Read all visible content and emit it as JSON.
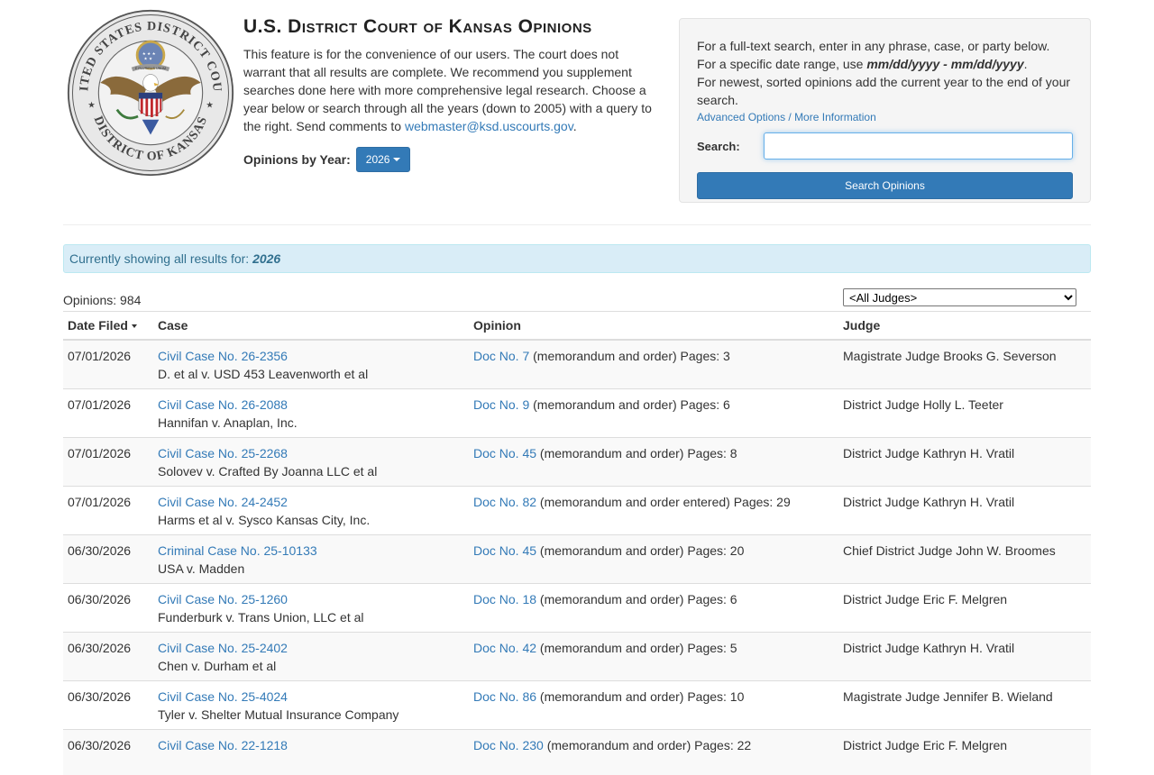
{
  "header": {
    "title": "U.S. District Court of Kansas Opinions",
    "intro_text": "This feature is for the convenience of our users. The court does not warrant that all results are complete. We recommend you supplement searches done here with more comprehensive legal research. Choose a year below or search through all the years (down to 2005) with a query to the right. Send comments to ",
    "email": "webmaster@ksd.uscourts.gov",
    "intro_end": ".",
    "year_label": "Opinions by Year:",
    "year_value": "2026"
  },
  "seal": {
    "top_text": "UNITED STATES DISTRICT COURT",
    "bottom_text": "DISTRICT OF KANSAS",
    "motto": "E PLURIBUS UNUM"
  },
  "search_panel": {
    "line1": "For a full-text search, enter in any phrase, case, or party below.",
    "line2_prefix": "For a specific date range, use ",
    "line2_format": "mm/dd/yyyy - mm/dd/yyyy",
    "line2_suffix": ".",
    "line3": "For newest, sorted opinions add the current year to the end of your search.",
    "advanced_link": "Advanced Options / More Information",
    "search_label": "Search:",
    "search_value": "",
    "button_label": "Search Opinions"
  },
  "results": {
    "alert_prefix": "Currently showing all results for: ",
    "alert_year": "2026",
    "count_text": "Opinions: 984",
    "judge_filter": "<All Judges>"
  },
  "table": {
    "headers": [
      "Date Filed",
      "Case",
      "Opinion",
      "Judge"
    ],
    "rows": [
      {
        "date": "07/01/2026",
        "case_no": "Civil Case No. 26-2356",
        "parties": "D. et al v. USD 453 Leavenworth et al",
        "doc": "Doc No. 7",
        "doc_desc": " (memorandum and order) Pages: 3",
        "judge": "Magistrate Judge Brooks G. Severson"
      },
      {
        "date": "07/01/2026",
        "case_no": "Civil Case No. 26-2088",
        "parties": "Hannifan v. Anaplan, Inc.",
        "doc": "Doc No. 9",
        "doc_desc": " (memorandum and order) Pages: 6",
        "judge": "District Judge Holly L. Teeter"
      },
      {
        "date": "07/01/2026",
        "case_no": "Civil Case No. 25-2268",
        "parties": "Solovev v. Crafted By Joanna LLC et al",
        "doc": "Doc No. 45",
        "doc_desc": " (memorandum and order) Pages: 8",
        "judge": "District Judge Kathryn H. Vratil"
      },
      {
        "date": "07/01/2026",
        "case_no": "Civil Case No. 24-2452",
        "parties": "Harms et al v. Sysco Kansas City, Inc.",
        "doc": "Doc No. 82",
        "doc_desc": " (memorandum and order entered) Pages: 29",
        "judge": "District Judge Kathryn H. Vratil"
      },
      {
        "date": "06/30/2026",
        "case_no": "Criminal Case No. 25-10133",
        "parties": "USA v. Madden",
        "doc": "Doc No. 45",
        "doc_desc": " (memorandum and order) Pages: 20",
        "judge": "Chief District Judge John W. Broomes"
      },
      {
        "date": "06/30/2026",
        "case_no": "Civil Case No. 25-1260",
        "parties": "Funderburk v. Trans Union, LLC et al",
        "doc": "Doc No. 18",
        "doc_desc": " (memorandum and order) Pages: 6",
        "judge": "District Judge Eric F. Melgren"
      },
      {
        "date": "06/30/2026",
        "case_no": "Civil Case No. 25-2402",
        "parties": "Chen v. Durham et al",
        "doc": "Doc No. 42",
        "doc_desc": " (memorandum and order) Pages: 5",
        "judge": "District Judge Kathryn H. Vratil"
      },
      {
        "date": "06/30/2026",
        "case_no": "Civil Case No. 25-4024",
        "parties": "Tyler v. Shelter Mutual Insurance Company",
        "doc": "Doc No. 86",
        "doc_desc": " (memorandum and order) Pages: 10",
        "judge": "Magistrate Judge Jennifer B. Wieland"
      },
      {
        "date": "06/30/2026",
        "case_no": "Civil Case No. 22-1218",
        "parties": "",
        "doc": "Doc No. 230",
        "doc_desc": " (memorandum and order) Pages: 22",
        "judge": "District Judge Eric F. Melgren"
      }
    ]
  }
}
